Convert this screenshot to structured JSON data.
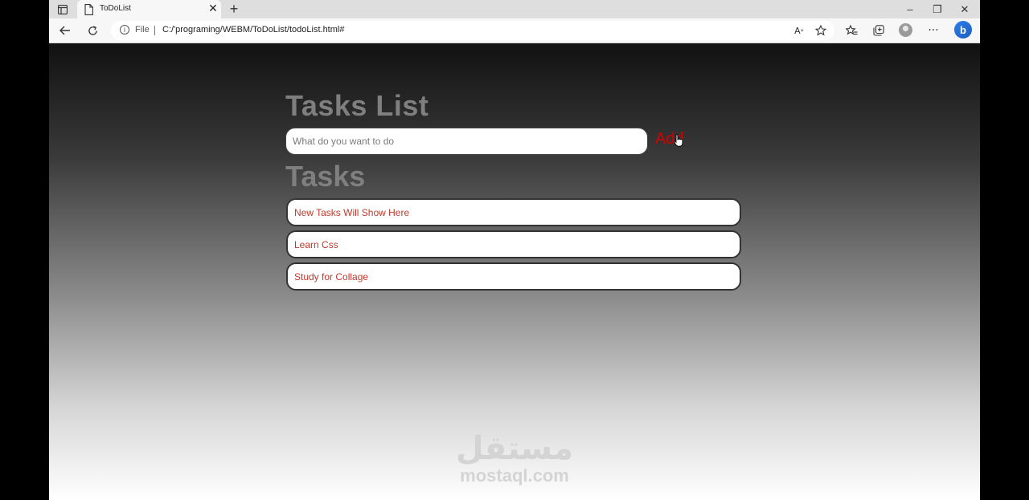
{
  "browser": {
    "tab_title": "ToDoList",
    "tab_close": "✕",
    "new_tab": "+",
    "file_label": "File",
    "url": "C:/'programing/WEBM/ToDoList/todoList.html#",
    "win_minimize": "–",
    "win_restore": "❐",
    "win_close": "✕"
  },
  "app": {
    "title": "Tasks List",
    "input_placeholder": "What do you want to do",
    "input_value": "",
    "add_label": "Add",
    "tasks_heading": "Tasks",
    "tasks": [
      "New Tasks Will Show Here",
      "Learn Css",
      "Study for Collage"
    ]
  },
  "watermark": {
    "arabic": "مستقل",
    "latin": "mostaql.com"
  },
  "colors": {
    "accent_red": "#d40000",
    "task_text": "#c0392b",
    "heading_gray": "#7f7f7f"
  }
}
